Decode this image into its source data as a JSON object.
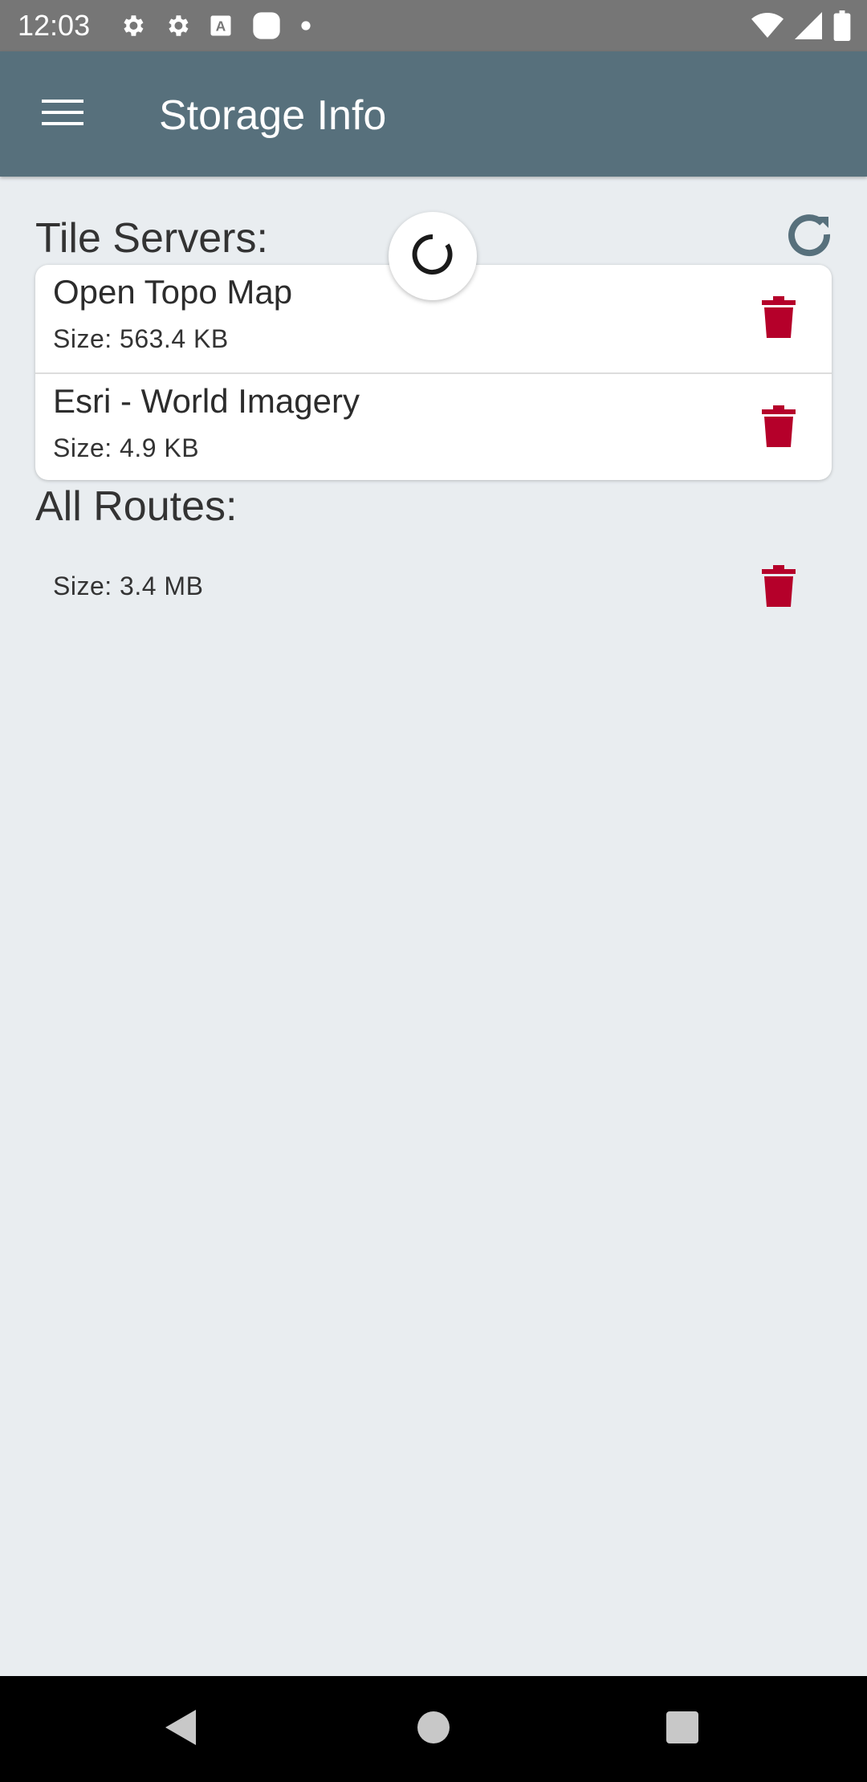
{
  "status_bar": {
    "time": "12:03",
    "left_icons": [
      "gear-icon",
      "gear-icon",
      "text-a-icon",
      "rounded-square-icon",
      "dot-icon"
    ],
    "right_icons": [
      "wifi-icon",
      "cell-signal-icon",
      "battery-icon"
    ]
  },
  "app_bar": {
    "title": "Storage Info",
    "menu_icon": "hamburger-icon"
  },
  "tile_servers": {
    "title": "Tile Servers:",
    "items": [
      {
        "name": "Open Topo Map",
        "size": "Size: 563.4 KB"
      },
      {
        "name": "Esri - World Imagery",
        "size": "Size: 4.9 KB"
      }
    ]
  },
  "all_routes": {
    "title": "All Routes:",
    "size": "Size: 3.4 MB"
  },
  "colors": {
    "app_bar": "#57707c",
    "background": "#e9edf0",
    "delete_red": "#b5002a",
    "refresh_icon": "#57707c"
  },
  "nav_bar": {
    "buttons": [
      "back-icon",
      "home-icon",
      "recents-icon"
    ]
  }
}
